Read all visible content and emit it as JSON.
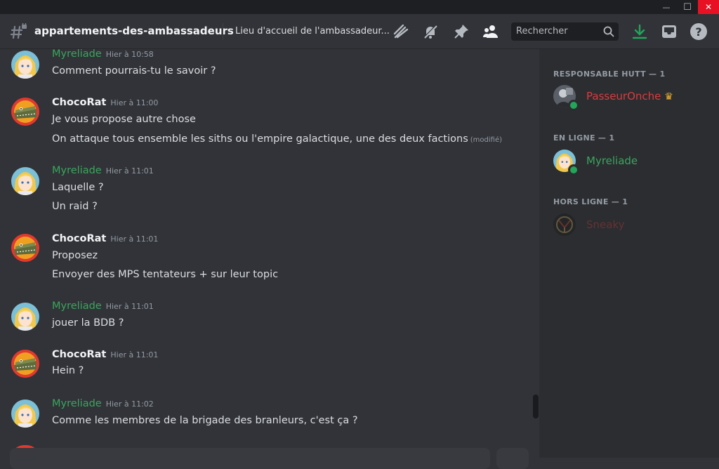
{
  "window": {
    "minimize_glyph": "—",
    "maximize_glyph": "☐",
    "close_glyph": "✕"
  },
  "channel": {
    "name": "appartements-des-ambassadeurs",
    "topic": "Lieu d'accueil de l'ambassadeur..."
  },
  "toolbar": {
    "icons": [
      "threads-icon",
      "mute-bell-icon",
      "pin-icon",
      "member-list-icon"
    ],
    "search_placeholder": "Rechercher",
    "right_icons": [
      "download-icon",
      "inbox-icon",
      "help-icon"
    ]
  },
  "messages": [
    {
      "author": "Myreliade",
      "author_color": "#3ba55c",
      "time": "Hier à 10:58",
      "avatar": "blonde-anime-girl",
      "lines": [
        "Comment pourrais-tu le savoir ?"
      ]
    },
    {
      "author": "ChocoRat",
      "author_color": "#f2f3f5",
      "time": "Hier à 11:00",
      "avatar": "crocodile-on-red",
      "lines": [
        "Je vous propose autre chose",
        "On attaque tous ensemble les siths ou l'empire galactique, une des deux factions"
      ],
      "edited": "(modifié)"
    },
    {
      "author": "Myreliade",
      "author_color": "#3ba55c",
      "time": "Hier à 11:01",
      "avatar": "blonde-anime-girl",
      "lines": [
        "Laquelle ?",
        "Un raid ?"
      ]
    },
    {
      "author": "ChocoRat",
      "author_color": "#f2f3f5",
      "time": "Hier à 11:01",
      "avatar": "crocodile-on-red",
      "lines": [
        "Proposez",
        "Envoyer des MPS tentateurs + sur leur topic"
      ]
    },
    {
      "author": "Myreliade",
      "author_color": "#3ba55c",
      "time": "Hier à 11:01",
      "avatar": "blonde-anime-girl",
      "lines": [
        "jouer la BDB ?"
      ]
    },
    {
      "author": "ChocoRat",
      "author_color": "#f2f3f5",
      "time": "Hier à 11:01",
      "avatar": "crocodile-on-red",
      "lines": [
        "Hein ?"
      ]
    },
    {
      "author": "Myreliade",
      "author_color": "#3ba55c",
      "time": "Hier à 11:02",
      "avatar": "blonde-anime-girl",
      "lines": [
        "Comme les membres de la brigade des branleurs, c'est ça ?"
      ]
    }
  ],
  "member_groups": [
    {
      "title": "RESPONSABLE HUTT — 1",
      "members": [
        {
          "name": "PasseurOnche",
          "color": "#d83c3e",
          "status": "online",
          "badge": "crown-icon",
          "badge_glyph": "♛"
        }
      ]
    },
    {
      "title": "EN LIGNE — 1",
      "members": [
        {
          "name": "Myreliade",
          "color": "#3ba55c",
          "status": "online"
        }
      ]
    },
    {
      "title": "HORS LIGNE — 1",
      "members": [
        {
          "name": "Sneaky",
          "color": "#5a3a2c",
          "status": "offline"
        }
      ]
    }
  ],
  "colors": {
    "background": "#313338",
    "sidebar": "#2b2d31",
    "green": "#23a55a",
    "download_green": "#23a55a",
    "crown": "#f0b232"
  }
}
